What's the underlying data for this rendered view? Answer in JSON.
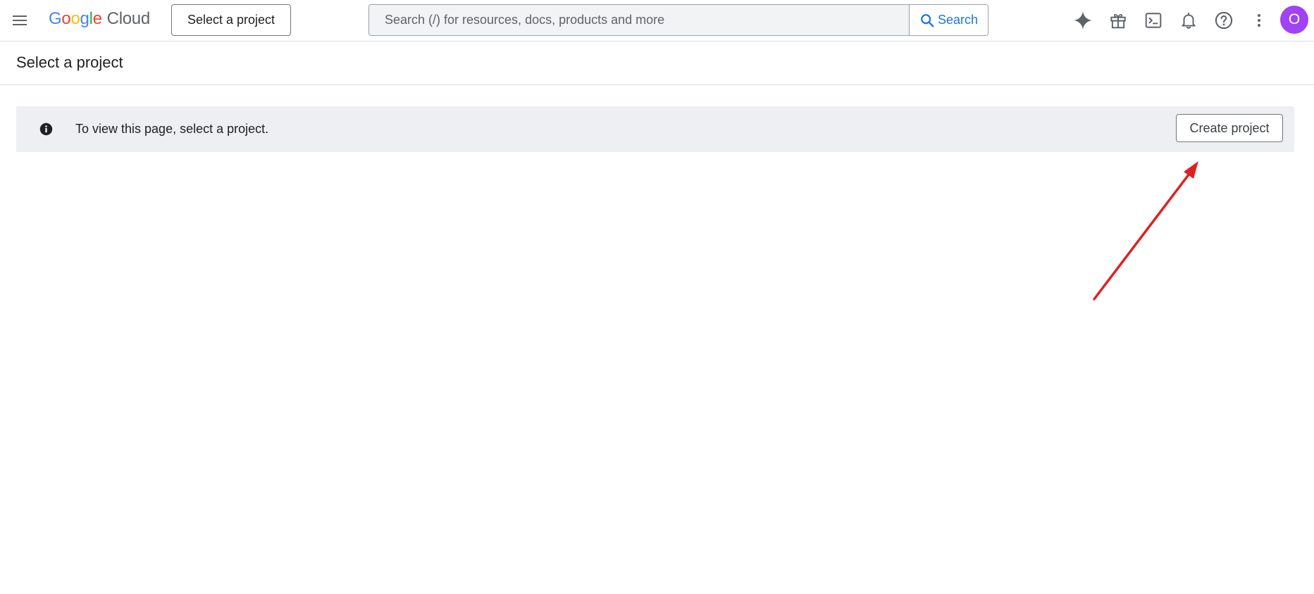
{
  "topbar": {
    "logo": {
      "google": "Google",
      "product": "Cloud"
    },
    "project_picker_label": "Select a project",
    "search": {
      "placeholder": "Search (/) for resources, docs, products and more",
      "value": "",
      "button_label": "Search"
    },
    "icons": [
      "gemini-icon",
      "gift-icon",
      "cloud-shell-icon",
      "notifications-icon",
      "help-icon",
      "more-vert-icon"
    ],
    "avatar_initial": "O"
  },
  "page": {
    "title": "Select a project"
  },
  "banner": {
    "message": "To view this page, select a project.",
    "create_button_label": "Create project"
  },
  "colors": {
    "accent": "#1a73e8",
    "avatar": "#a142f4",
    "banner_bg": "#eeeff2",
    "annotation_arrow": "#e02020"
  }
}
